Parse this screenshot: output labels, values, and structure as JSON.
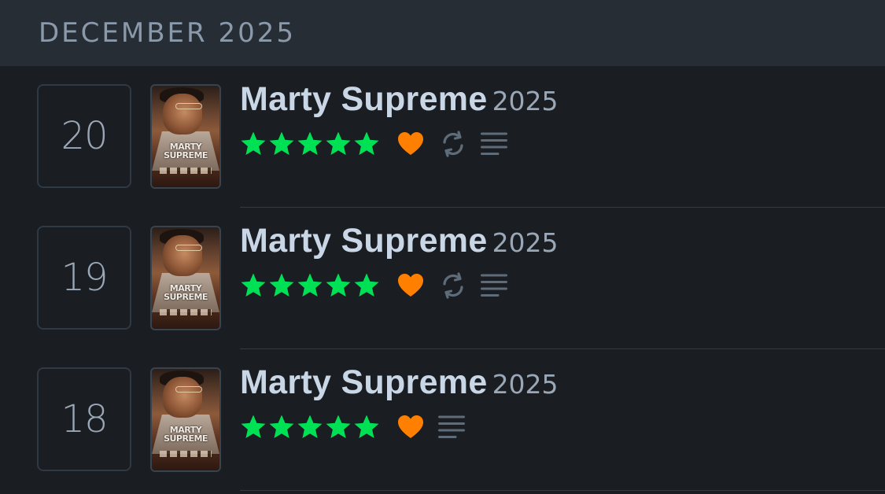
{
  "month_header": {
    "label": "DECEMBER 2025"
  },
  "entries": [
    {
      "day": "20",
      "poster_text": "MARTY SUPREME",
      "title": "Marty Supreme",
      "year": "2025",
      "rating_stars": 5,
      "liked": true,
      "rewatch": true,
      "has_review": true
    },
    {
      "day": "19",
      "poster_text": "MARTY SUPREME",
      "title": "Marty Supreme",
      "year": "2025",
      "rating_stars": 5,
      "liked": true,
      "rewatch": true,
      "has_review": true
    },
    {
      "day": "18",
      "poster_text": "MARTY SUPREME",
      "title": "Marty Supreme",
      "year": "2025",
      "rating_stars": 5,
      "liked": true,
      "rewatch": false,
      "has_review": true
    }
  ],
  "colors": {
    "star": "#00e054",
    "heart": "#ff8000",
    "icon_muted": "#5e6b79",
    "background": "#1a1d22",
    "header_bg": "#262d35"
  },
  "icons": {
    "star": "star-icon",
    "heart": "heart-icon",
    "rewatch": "rewatch-icon",
    "review": "review-lines-icon"
  }
}
